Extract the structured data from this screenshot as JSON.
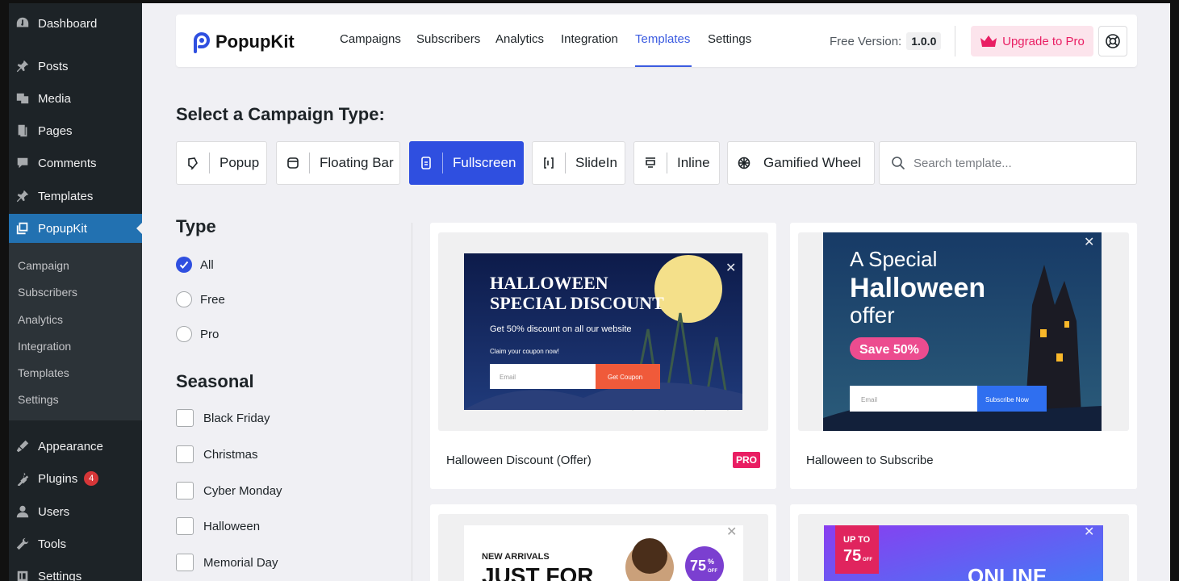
{
  "wp_sidebar": {
    "items": [
      {
        "label": "Dashboard",
        "icon": "dashboard-icon"
      },
      {
        "label": "Posts",
        "icon": "pin-icon"
      },
      {
        "label": "Media",
        "icon": "media-icon"
      },
      {
        "label": "Pages",
        "icon": "pages-icon"
      },
      {
        "label": "Comments",
        "icon": "comments-icon"
      },
      {
        "label": "Templates",
        "icon": "pin-icon"
      },
      {
        "label": "PopupKit",
        "icon": "popupkit-icon"
      },
      {
        "label": "Appearance",
        "icon": "appearance-icon"
      },
      {
        "label": "Plugins",
        "icon": "plugins-icon",
        "badge": "4"
      },
      {
        "label": "Users",
        "icon": "users-icon"
      },
      {
        "label": "Tools",
        "icon": "tools-icon"
      },
      {
        "label": "Settings",
        "icon": "settings-icon"
      }
    ],
    "submenu": [
      "Campaign",
      "Subscribers",
      "Analytics",
      "Integration",
      "Templates",
      "Settings"
    ]
  },
  "header": {
    "logo": "PopupKit",
    "nav": [
      "Campaigns",
      "Subscribers",
      "Analytics",
      "Integration",
      "Templates",
      "Settings"
    ],
    "active_nav": "Templates",
    "version_label": "Free Version:",
    "version": "1.0.0",
    "upgrade_label": "Upgrade to Pro"
  },
  "page": {
    "heading": "Select a Campaign Type:",
    "campaign_types": [
      "Popup",
      "Floating Bar",
      "Fullscreen",
      "SlideIn",
      "Inline",
      "Gamified Wheel"
    ],
    "active_type": "Fullscreen",
    "search_placeholder": "Search template..."
  },
  "filters": {
    "type_heading": "Type",
    "types": [
      "All",
      "Free",
      "Pro"
    ],
    "selected_type": "All",
    "seasonal_heading": "Seasonal",
    "seasonal": [
      "Black Friday",
      "Christmas",
      "Cyber Monday",
      "Halloween",
      "Memorial Day"
    ]
  },
  "templates": [
    {
      "title": "Halloween Discount (Offer)",
      "badge": "PRO",
      "preview": {
        "headline1": "HALLOWEEN",
        "headline2": "SPECIAL DISCOUNT",
        "sub": "Get 50% discount on all our website",
        "claim": "Claim your coupon now!",
        "email": "Email",
        "button": "Get Coupon"
      }
    },
    {
      "title": "Halloween to Subscribe",
      "badge": "",
      "preview": {
        "line1": "A Special",
        "line2": "Halloween",
        "line3": "offer",
        "save": "Save 50%",
        "email": "Email",
        "button": "Subscribe Now"
      }
    },
    {
      "title": "",
      "preview": {
        "kicker": "NEW ARRIVALS",
        "headline": "JUST FOR",
        "pct": "75",
        "pct_sign": "%",
        "off": "OFF"
      }
    },
    {
      "title": "",
      "preview": {
        "upto": "UP TO",
        "pct": "75",
        "off": "OFF",
        "headline": "ONLINE"
      }
    }
  ]
}
